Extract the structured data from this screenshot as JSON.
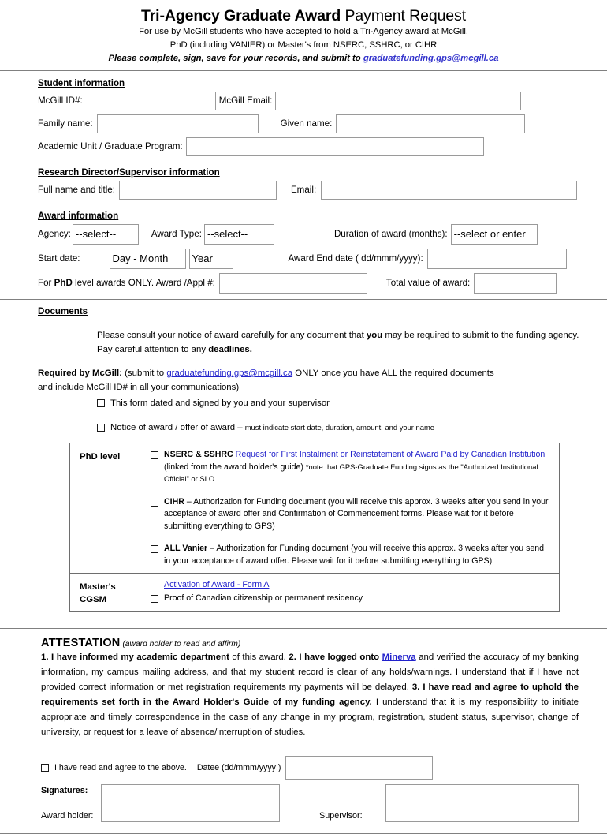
{
  "header": {
    "title_bold": "Tri-Agency Graduate Award",
    "title_light": " Payment Request",
    "line1": "For use by McGill students who have accepted to hold a Tri-Agency award at McGill.",
    "line2": "PhD (including VANIER) or Master's from NSERC, SSHRC, or CIHR",
    "line3_prefix": "Please complete, sign, save for your records, and submit to ",
    "email_link": "graduatefunding.gps@mcgill.ca",
    "link_color": "#3333cc"
  },
  "student": {
    "heading": "Student information",
    "mcgill_id_label": "McGill ID#:",
    "mcgill_id_value": "",
    "mcgill_email_label": "McGill Email:",
    "mcgill_email_value": "",
    "family_name_label": "Family name:",
    "family_name_value": "",
    "given_name_label": "Given name:",
    "given_name_value": "",
    "academic_unit_label": "Academic Unit / Graduate Program:",
    "academic_unit_value": ""
  },
  "supervisor": {
    "heading": "Research Director/Supervisor information",
    "full_name_label": "Full name and title:",
    "full_name_value": "",
    "email_label": "Email:",
    "email_value": ""
  },
  "award": {
    "heading": "Award information",
    "agency_label": "Agency:",
    "agency_value": "--select--",
    "award_type_label": "Award Type:",
    "award_type_value": "--select--",
    "duration_label": "Duration of award (months):",
    "duration_value": "--select or enter",
    "start_date_label": "Start date:",
    "start_day_month_value": "Day - Month",
    "start_year_value": "Year",
    "end_date_label": "Award End date ( dd/mmm/yyyy):",
    "end_date_value": "",
    "phd_only_prefix": "For ",
    "phd_only_bold": "PhD",
    "phd_only_suffix": " level awards ONLY.   Award /Appl #:",
    "appl_number_value": "",
    "total_value_label": "Total value of award:",
    "total_value_value": ""
  },
  "documents": {
    "heading": "Documents",
    "para1_a": "Please consult your notice of award carefully for any document that ",
    "para1_bold": "you",
    "para1_b": " may be required to submit to the funding agency.",
    "para2_a": "Pay careful attention to any ",
    "para2_bold": "deadlines.",
    "required_bold": "Required by McGill:",
    "required_a": " (submit to ",
    "required_link": "graduatefunding.gps@mcgill.ca",
    "required_b": " ONLY once you have ALL the required documents",
    "required_line2": "and include McGill ID# in all your communications)",
    "check1": "This form dated and signed by you and your supervisor",
    "check2_a": "Notice of award / offer of award – ",
    "check2_small": "must indicate start date, duration, amount, and your name"
  },
  "doc_table": {
    "phd_label": "PhD level",
    "masters_label_line1": "Master's",
    "masters_label_line2": "CGSM",
    "phd_items": [
      {
        "bold": "NSERC & SSHRC",
        "link": "Request for First Instalment or Reinstatement of Award Paid by Canadian Institution",
        "after_link": " (linked from the award holder's guide) ",
        "note": "*note that GPS-Graduate Funding signs as the \"Authorized Institutional Official\" or SLO."
      },
      {
        "bold": "CIHR",
        "text": " – Authorization for Funding document (you will receive this approx. 3 weeks after you send in your acceptance of award offer and Confirmation of Commencement forms. Please wait for it before submitting everything to GPS)"
      },
      {
        "bold": "ALL Vanier",
        "text": " – Authorization for Funding document (you will receive this approx. 3 weeks after you send in your acceptance of award offer. Please wait for it before submitting everything to GPS)"
      }
    ],
    "masters_items": [
      {
        "link": "Activation of Award - Form A"
      },
      {
        "text": "Proof of Canadian citizenship or permanent residency"
      }
    ]
  },
  "attestation": {
    "heading": "ATTESTATION",
    "heading_sub": " (award holder to read and affirm)",
    "p_1_bold": "1. I have informed my academic department",
    "p_2_plain": " of this award. ",
    "p_3_bold": "2. I have logged onto ",
    "p_minerva_link": "Minerva",
    "p_4_plain": " and verified the accuracy of my banking information, my campus mailing address, and that my student record is clear of any holds/warnings. I understand that if I have not provided correct information or met registration requirements my payments will be delayed. ",
    "p_5_bold": "3. I have read and agree to uphold the requirements set forth in the Award Holder's Guide of my funding agency.",
    "p_6_plain": " I understand that it is my responsibility to initiate appropriate and timely correspondence in the case of any change in my program, registration, student status, supervisor, change of university, or request for a leave of absence/interruption of studies.",
    "agree_checkbox_label": "I have read and agree to the above.",
    "date_label": "Datee (dd/mmm/yyyy:)",
    "date_value": "",
    "signatures_label": "Signatures:",
    "award_holder_label": "Award holder:",
    "award_holder_value": "",
    "supervisor_label": "Supervisor:",
    "supervisor_value": ""
  }
}
